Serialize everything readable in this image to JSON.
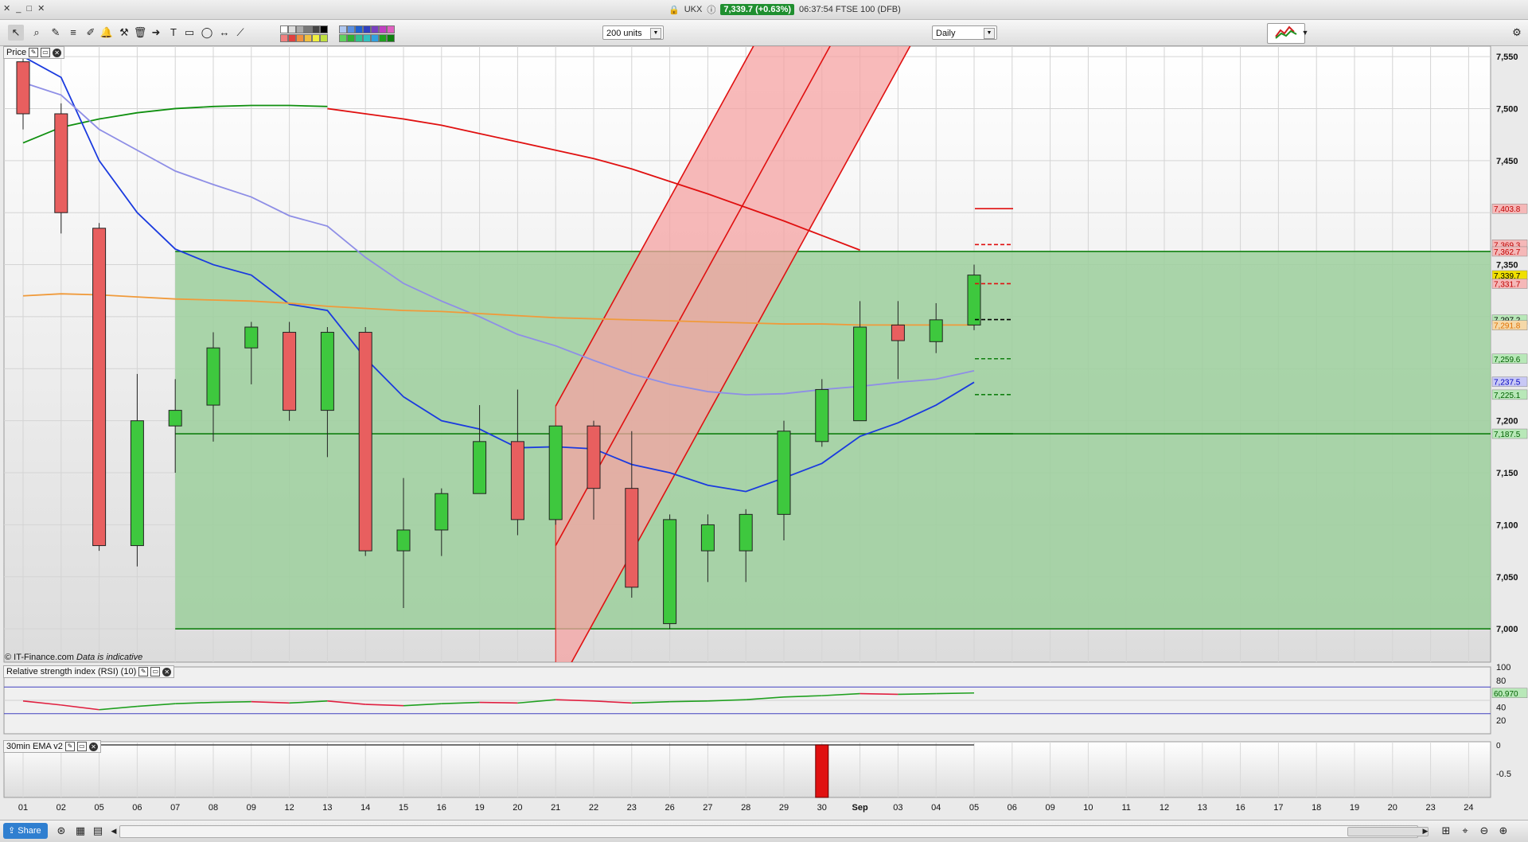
{
  "titlebar": {
    "symbol": "UKX",
    "quote": "7,339.7 (+0.63%)",
    "time_name": "06:37:54 FTSE 100 (DFB)"
  },
  "toolbar": {
    "units": "200 units",
    "period": "Daily"
  },
  "price_panel": {
    "header": "Price",
    "copyright": "© IT-Finance.com",
    "disclaimer": "Data is indicative",
    "axis_ticks": [
      "7,550",
      "7,500",
      "7,450",
      "7,350",
      "7,200",
      "7,150",
      "7,100",
      "7,050",
      "7,000"
    ],
    "price_labels": [
      {
        "text": "7,403.8",
        "bg": "#f5b8b8",
        "fg": "#c00000"
      },
      {
        "text": "7,369.3",
        "bg": "#f5b8b8",
        "fg": "#c00000"
      },
      {
        "text": "7,362.7",
        "bg": "#f5b8b8",
        "fg": "#c00000"
      },
      {
        "text": "7,339.7",
        "bg": "#f0e000",
        "fg": "#000000"
      },
      {
        "text": "7,331.7",
        "bg": "#f5b8b8",
        "fg": "#c00000"
      },
      {
        "text": "7,297.2",
        "bg": "#b8e8b8",
        "fg": "#000000"
      },
      {
        "text": "7,291.8",
        "bg": "#f5d8a8",
        "fg": "#e07000"
      },
      {
        "text": "7,259.6",
        "bg": "#b8e8b8",
        "fg": "#006000"
      },
      {
        "text": "7,237.5",
        "bg": "#c8c8f5",
        "fg": "#0000c0"
      },
      {
        "text": "7,225.1",
        "bg": "#b8e8b8",
        "fg": "#006000"
      },
      {
        "text": "7,187.5",
        "bg": "#b8e8b8",
        "fg": "#006000"
      }
    ]
  },
  "rsi_panel": {
    "header": "Relative strength index (RSI) (10)",
    "value_label": "60.970",
    "axis_ticks": [
      "100",
      "80",
      "40",
      "20"
    ]
  },
  "ema_panel": {
    "header": "30min EMA v2",
    "axis_ticks": [
      "0",
      "-0.5"
    ]
  },
  "x_axis": {
    "labels": [
      "01",
      "02",
      "05",
      "06",
      "07",
      "08",
      "09",
      "12",
      "13",
      "14",
      "15",
      "16",
      "19",
      "20",
      "21",
      "22",
      "23",
      "26",
      "27",
      "28",
      "29",
      "30",
      "Sep",
      "03",
      "04",
      "05",
      "06",
      "09",
      "10",
      "11",
      "12",
      "13",
      "16",
      "17",
      "18",
      "19",
      "20",
      "23",
      "24"
    ]
  },
  "bottombar": {
    "share_label": "Share"
  },
  "colors": {
    "bull": "#3ec83e",
    "bear": "#e85f5f",
    "green_zone": "#9ccf9c",
    "red_channel": "#f5a3a3",
    "ma_red": "#e01010",
    "ma_green": "#109010",
    "ma_blue": "#1a3adf",
    "ma_lightblue": "#8e8ee6",
    "ma_orange": "#f09a3a"
  },
  "chart_data": {
    "type": "candlestick",
    "x": [
      "01",
      "02",
      "05",
      "06",
      "07",
      "08",
      "09",
      "12",
      "13",
      "14",
      "15",
      "16",
      "19",
      "20",
      "21",
      "22",
      "23",
      "26",
      "27",
      "28",
      "29",
      "30",
      "Sep",
      "03",
      "04",
      "05"
    ],
    "candles": [
      {
        "o": 7545,
        "h": 7560,
        "l": 7480,
        "c": 7495
      },
      {
        "o": 7495,
        "h": 7505,
        "l": 7380,
        "c": 7400
      },
      {
        "o": 7385,
        "h": 7390,
        "l": 7075,
        "c": 7080
      },
      {
        "o": 7080,
        "h": 7245,
        "l": 7060,
        "c": 7200
      },
      {
        "o": 7195,
        "h": 7240,
        "l": 7150,
        "c": 7210
      },
      {
        "o": 7215,
        "h": 7285,
        "l": 7180,
        "c": 7270
      },
      {
        "o": 7270,
        "h": 7295,
        "l": 7235,
        "c": 7290
      },
      {
        "o": 7285,
        "h": 7295,
        "l": 7200,
        "c": 7210
      },
      {
        "o": 7210,
        "h": 7290,
        "l": 7165,
        "c": 7285
      },
      {
        "o": 7285,
        "h": 7290,
        "l": 7070,
        "c": 7075
      },
      {
        "o": 7075,
        "h": 7145,
        "l": 7020,
        "c": 7095
      },
      {
        "o": 7095,
        "h": 7135,
        "l": 7070,
        "c": 7130
      },
      {
        "o": 7130,
        "h": 7215,
        "l": 7130,
        "c": 7180
      },
      {
        "o": 7180,
        "h": 7230,
        "l": 7090,
        "c": 7105
      },
      {
        "o": 7105,
        "h": 7195,
        "l": 7100,
        "c": 7195
      },
      {
        "o": 7195,
        "h": 7200,
        "l": 7105,
        "c": 7135
      },
      {
        "o": 7135,
        "h": 7190,
        "l": 7030,
        "c": 7040
      },
      {
        "o": 7005,
        "h": 7110,
        "l": 7000,
        "c": 7105
      },
      {
        "o": 7075,
        "h": 7110,
        "l": 7045,
        "c": 7100
      },
      {
        "o": 7075,
        "h": 7115,
        "l": 7045,
        "c": 7110
      },
      {
        "o": 7110,
        "h": 7200,
        "l": 7085,
        "c": 7190
      },
      {
        "o": 7180,
        "h": 7240,
        "l": 7175,
        "c": 7230
      },
      {
        "o": 7200,
        "h": 7315,
        "l": 7200,
        "c": 7290
      },
      {
        "o": 7292,
        "h": 7315,
        "l": 7240,
        "c": 7277
      },
      {
        "o": 7276,
        "h": 7313,
        "l": 7265,
        "c": 7297
      },
      {
        "o": 7292,
        "h": 7350,
        "l": 7287,
        "c": 7340
      }
    ],
    "moving_averages": [
      {
        "color": "#e01010",
        "values": [
          null,
          null,
          null,
          null,
          null,
          null,
          null,
          null,
          7500,
          7495,
          7490,
          7484,
          7476,
          7468,
          7460,
          7452,
          7442,
          7430,
          7418,
          7405,
          7392,
          7378,
          7364
        ]
      },
      {
        "color": "#109010",
        "values": [
          7467,
          7482,
          7490,
          7496,
          7500,
          7502,
          7503,
          7503,
          7502
        ]
      },
      {
        "color": "#1a3adf",
        "values": [
          7550,
          7530,
          7450,
          7400,
          7365,
          7350,
          7340,
          7312,
          7306,
          7260,
          7223,
          7200,
          7192,
          7174,
          7175,
          7173,
          7158,
          7150,
          7138,
          7132,
          7145,
          7159,
          7185,
          7198,
          7215,
          7237
        ]
      },
      {
        "color": "#8e8ee6",
        "values": [
          7525,
          7513,
          7480,
          7460,
          7440,
          7427,
          7415,
          7397,
          7387,
          7357,
          7332,
          7315,
          7300,
          7283,
          7272,
          7258,
          7245,
          7235,
          7228,
          7225,
          7226,
          7230,
          7233,
          7237,
          7240,
          7248
        ]
      },
      {
        "color": "#f09a3a",
        "values": [
          7320,
          7322,
          7321,
          7319,
          7317,
          7316,
          7315,
          7313,
          7310,
          7308,
          7306,
          7305,
          7303,
          7301,
          7299,
          7298,
          7297,
          7296,
          7295,
          7294,
          7293,
          7293,
          7292,
          7292,
          7292,
          7292
        ]
      }
    ],
    "levels": [
      7362.7,
      7187.5,
      7000
    ],
    "rsi": {
      "values": [
        49,
        43,
        36,
        41,
        45,
        47,
        48,
        46,
        49,
        44,
        42,
        45,
        47,
        46,
        51,
        49,
        46,
        48,
        49,
        51,
        55,
        57,
        60,
        59,
        60,
        61
      ],
      "bands": [
        70,
        30
      ],
      "ylim": [
        0,
        100
      ]
    },
    "ylim": [
      6968,
      7560
    ]
  }
}
